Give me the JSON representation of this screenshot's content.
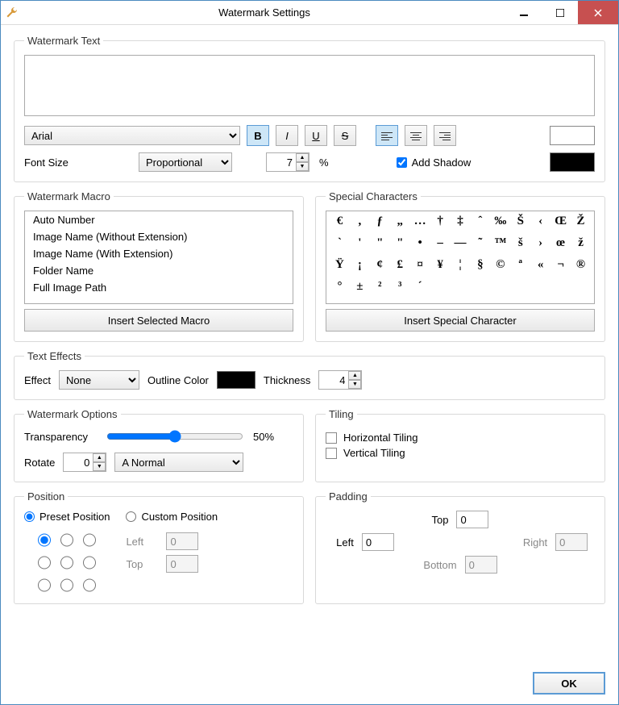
{
  "window": {
    "title": "Watermark Settings"
  },
  "wm_text": {
    "legend": "Watermark Text",
    "value": "",
    "font": "Arial",
    "font_size_label": "Font Size",
    "size_mode": "Proportional",
    "size_value": "7",
    "size_unit": "%",
    "add_shadow_label": "Add Shadow",
    "add_shadow_checked": true,
    "text_color": "#ffffff",
    "shadow_color": "#000000"
  },
  "macro": {
    "legend": "Watermark Macro",
    "items": [
      "Auto Number",
      "Image Name (Without Extension)",
      "Image Name (With Extension)",
      "Folder Name",
      "Full Image Path"
    ],
    "button": "Insert Selected Macro"
  },
  "special": {
    "legend": "Special Characters",
    "chars": [
      "€",
      ",",
      "ƒ",
      "„",
      "…",
      "†",
      "‡",
      "ˆ",
      "‰",
      "Š",
      "‹",
      "Œ",
      "Ž",
      "`",
      "'",
      "\"",
      "\"",
      "•",
      "–",
      "—",
      "˜",
      "™",
      "š",
      "›",
      "œ",
      "ž",
      "Ÿ",
      "¡",
      "¢",
      "£",
      "¤",
      "¥",
      "¦",
      "§",
      "©",
      "ª",
      "«",
      "¬",
      "®",
      "°",
      "±",
      "²",
      "³",
      "´"
    ],
    "button": "Insert Special Character"
  },
  "effects": {
    "legend": "Text Effects",
    "effect_label": "Effect",
    "effect_value": "None",
    "outline_label": "Outline Color",
    "outline_color": "#000000",
    "thickness_label": "Thickness",
    "thickness_value": "4"
  },
  "options": {
    "legend": "Watermark Options",
    "transparency_label": "Transparency",
    "transparency_value": "50%",
    "rotate_label": "Rotate",
    "rotate_value": "0",
    "flip_value": "Normal"
  },
  "tiling": {
    "legend": "Tiling",
    "horizontal": "Horizontal Tiling",
    "vertical": "Vertical Tiling",
    "h_checked": false,
    "v_checked": false
  },
  "position": {
    "legend": "Position",
    "preset_label": "Preset Position",
    "custom_label": "Custom Position",
    "mode": "preset",
    "preset_index": 0,
    "left_label": "Left",
    "top_label": "Top",
    "left_value": "0",
    "top_value": "0"
  },
  "padding": {
    "legend": "Padding",
    "top_label": "Top",
    "top_value": "0",
    "left_label": "Left",
    "left_value": "0",
    "right_label": "Right",
    "right_value": "0",
    "bottom_label": "Bottom",
    "bottom_value": "0"
  },
  "ok": "OK"
}
